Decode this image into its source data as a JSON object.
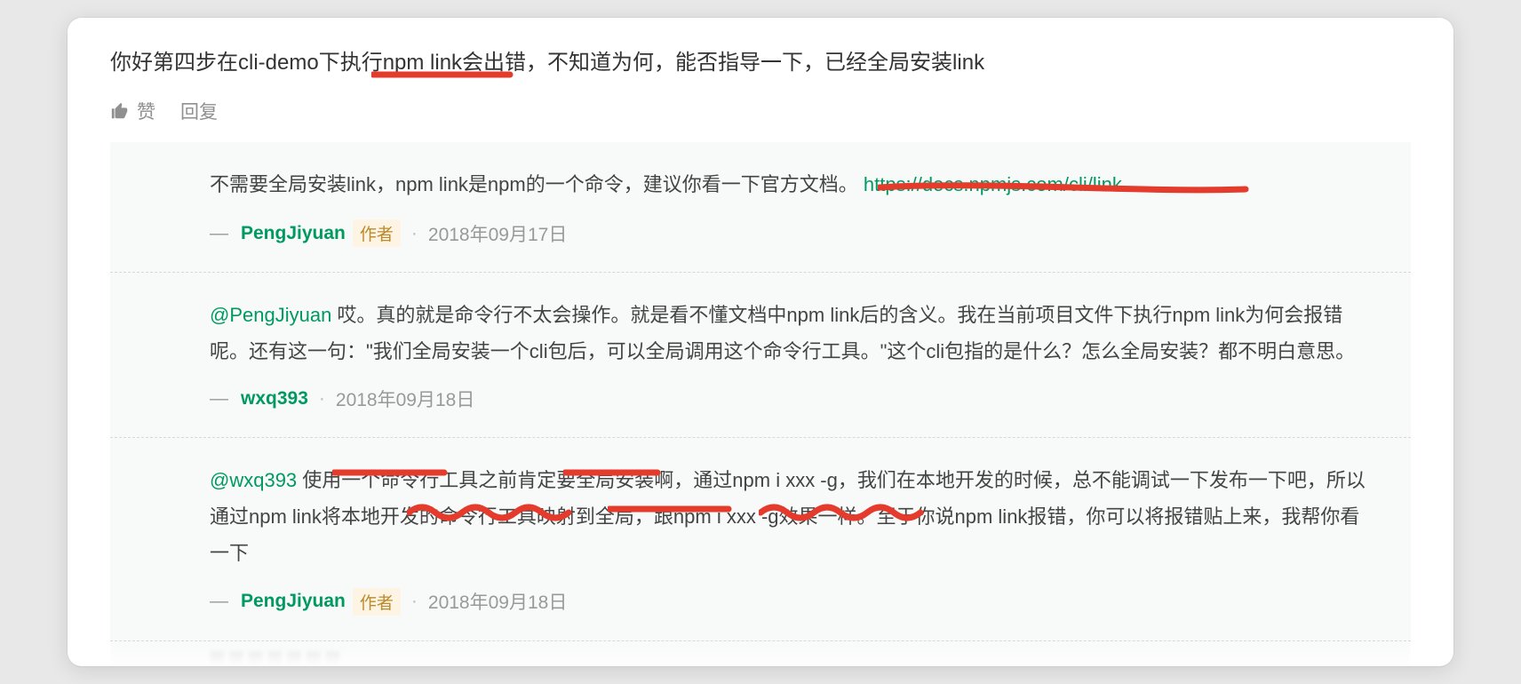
{
  "rootComment": {
    "text": "你好第四步在cli-demo下执行npm link会出错，不知道为何，能否指导一下，已经全局安装link"
  },
  "actions": {
    "like": "赞",
    "reply": "回复"
  },
  "authorBadge": "作者",
  "replies": [
    {
      "bodyPre": "不需要全局安装link，npm link是npm的一个命令，建议你看一下官方文档。",
      "linkText": "https://docs.npmjs.com/cli/link",
      "author": "PengJiyuan",
      "hasBadge": true,
      "date": "2018年09月17日"
    },
    {
      "mention": "@PengJiyuan",
      "body": " 哎。真的就是命令行不太会操作。就是看不懂文档中npm link后的含义。我在当前项目文件下执行npm link为何会报错呢。还有这一句：\"我们全局安装一个cli包后，可以全局调用这个命令行工具。\"这个cli包指的是什么？怎么全局安装？都不明白意思。",
      "author": "wxq393",
      "hasBadge": false,
      "date": "2018年09月18日"
    },
    {
      "mention": "@wxq393",
      "body": " 使用一个命令行工具之前肯定要全局安装啊，通过npm i xxx -g，我们在本地开发的时候，总不能调试一下发布一下吧，所以通过npm link将本地开发的命令行工具映射到全局，跟npm i xxx -g效果一样。至于你说npm link报错，你可以将报错贴上来，我帮你看一下",
      "author": "PengJiyuan",
      "hasBadge": true,
      "date": "2018年09月18日"
    }
  ]
}
